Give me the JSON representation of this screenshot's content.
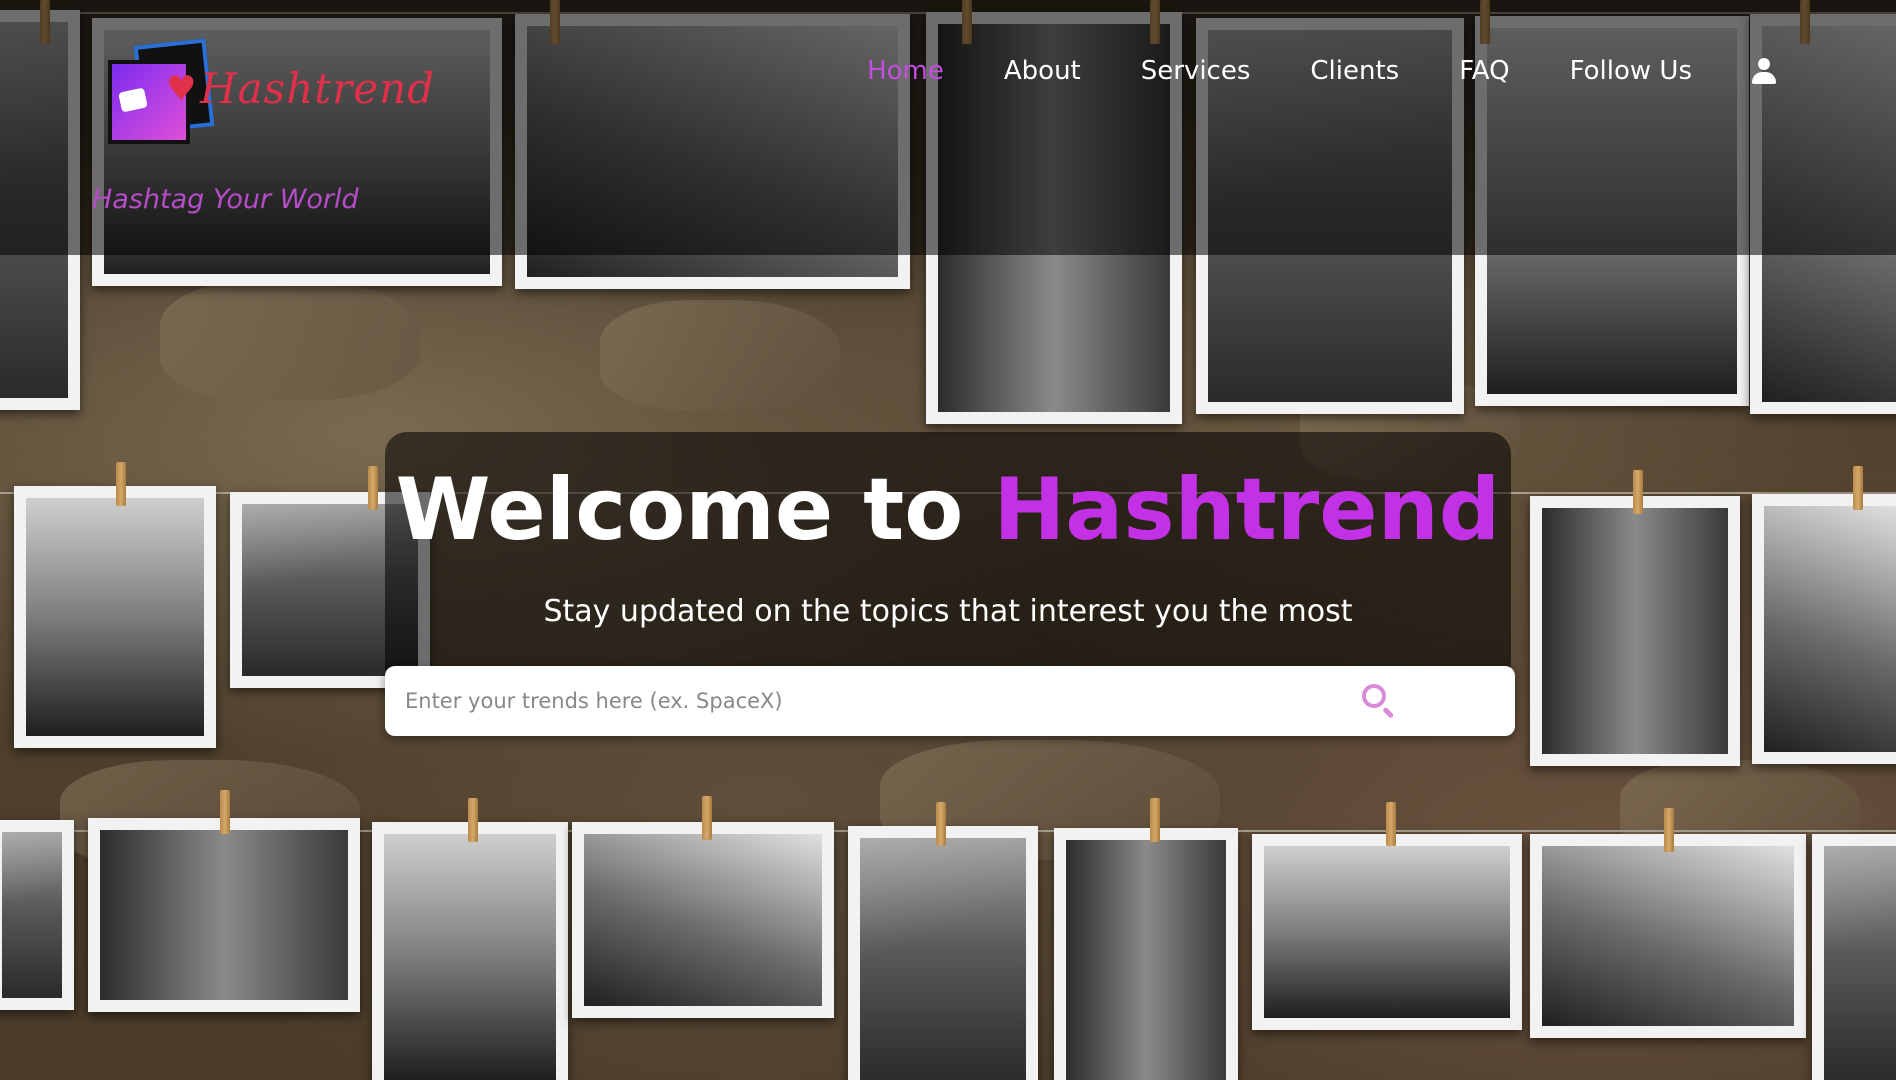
{
  "brand": {
    "logo_text": "Hashtrend",
    "tagline": "Hashtag Your World"
  },
  "nav": {
    "items": [
      {
        "label": "Home",
        "active": true
      },
      {
        "label": "About",
        "active": false
      },
      {
        "label": "Services",
        "active": false
      },
      {
        "label": "Clients",
        "active": false
      },
      {
        "label": "FAQ",
        "active": false
      },
      {
        "label": "Follow Us",
        "active": false
      }
    ],
    "account_icon": "user-icon"
  },
  "hero": {
    "title_prefix": "Welcome to ",
    "title_brand": "Hashtrend",
    "subtitle": "Stay updated on the topics that interest you the most"
  },
  "search": {
    "placeholder": "Enter your trends here (ex. SpaceX)",
    "value": "",
    "button_icon": "search-icon"
  },
  "colors": {
    "accent": "#c331e6",
    "nav_active": "#c34ee0",
    "logo_red": "#e0304a",
    "tagline": "#b64cc8",
    "search_icon": "#d98ad8"
  }
}
